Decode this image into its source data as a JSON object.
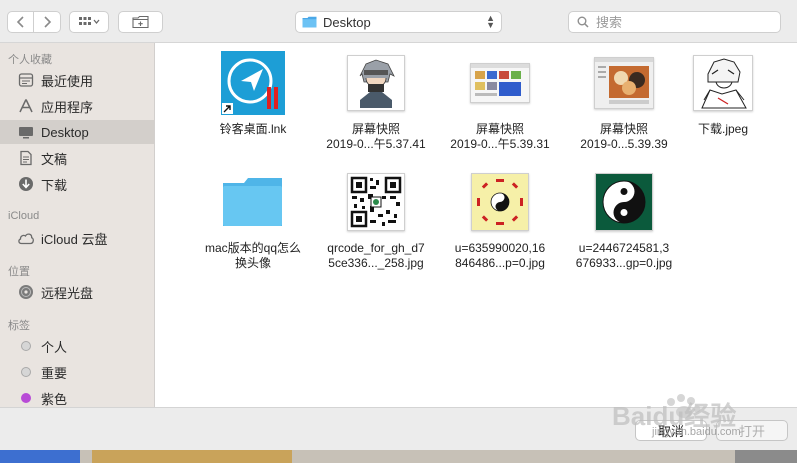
{
  "toolbar": {
    "location": "Desktop",
    "search_placeholder": "搜索"
  },
  "sidebar": {
    "favorites_title": "个人收藏",
    "favorites": [
      {
        "label": "最近使用",
        "icon": "clock-icon"
      },
      {
        "label": "应用程序",
        "icon": "applications-icon"
      },
      {
        "label": "Desktop",
        "icon": "desktop-icon",
        "selected": true
      },
      {
        "label": "文稿",
        "icon": "document-icon"
      },
      {
        "label": "下载",
        "icon": "download-icon"
      }
    ],
    "icloud_title": "iCloud",
    "icloud": [
      {
        "label": "iCloud 云盘",
        "icon": "cloud-icon"
      }
    ],
    "locations_title": "位置",
    "locations": [
      {
        "label": "远程光盘",
        "icon": "disc-icon"
      }
    ],
    "tags_title": "标签",
    "tags": [
      {
        "label": "个人",
        "color": "#c8c8c8"
      },
      {
        "label": "重要",
        "color": "#c8c8c8"
      },
      {
        "label": "紫色",
        "color": "#b84bd6"
      }
    ]
  },
  "files": [
    {
      "line1": "铃客桌面.lnk",
      "line2": ""
    },
    {
      "line1": "屏幕快照",
      "line2": "2019-0...午5.37.41"
    },
    {
      "line1": "屏幕快照",
      "line2": "2019-0...午5.39.31"
    },
    {
      "line1": "屏幕快照",
      "line2": "2019-0...5.39.39"
    },
    {
      "line1": "下载.jpeg",
      "line2": ""
    },
    {
      "line1": "mac版本的qq怎么",
      "line2": "换头像"
    },
    {
      "line1": "qrcode_for_gh_d7",
      "line2": "5ce336..._258.jpg"
    },
    {
      "line1": "u=635990020,16",
      "line2": "846486...p=0.jpg"
    },
    {
      "line1": "u=2446724581,3",
      "line2": "676933...gp=0.jpg"
    }
  ],
  "buttons": {
    "cancel": "取消",
    "open": "打开"
  },
  "watermark": {
    "brand": "Baidu经验",
    "url": "jingyan.baidu.com"
  },
  "colors": {
    "folder": "#5ac8f5",
    "sidebar_selected": "#d3cfcb",
    "purple_tag": "#b84bd6"
  }
}
